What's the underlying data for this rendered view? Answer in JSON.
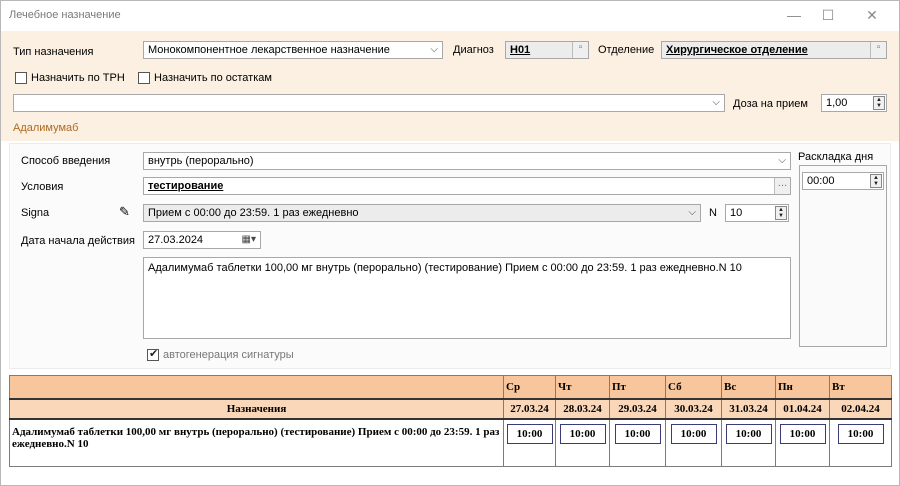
{
  "window": {
    "title": "Лечебное назначение",
    "min": "—",
    "max": "☐",
    "close": "✕"
  },
  "header": {
    "type_label": "Тип назначения",
    "type_value": "Монокомпонентное лекарственное назначение",
    "diagnosis_label": "Диагноз",
    "diagnosis_value": "H01",
    "department_label": "Отделение",
    "department_value": "Хирургическое отделение",
    "check_trn": "Назначить по ТРН",
    "check_stock": "Назначить по остаткам",
    "drug_value": "",
    "dose_label": "Доза на прием",
    "dose_value": "1,00",
    "drug_name": "Адалимумаб"
  },
  "form": {
    "route_label": "Способ введения",
    "route_value": "внутрь (перорально)",
    "conditions_label": "Условия",
    "conditions_value": "тестирование",
    "signa_label": "Signa",
    "signa_value": "Прием с 00:00 до 23:59. 1 раз ежедневно",
    "n_label": "N",
    "n_value": "10",
    "start_label": "Дата начала действия",
    "start_value": "27.03.2024",
    "summary_text": "Адалимумаб таблетки 100,00 мг  внутрь (перорально) (тестирование)  Прием с 00:00 до 23:59. 1 раз ежедневно.N 10",
    "autogen_label": "автогенерация сигнатуры",
    "layout_label": "Раскладка дня",
    "layout_time": "00:00"
  },
  "schedule": {
    "col_header": "Назначения",
    "days": [
      "Ср",
      "Чт",
      "Пт",
      "Сб",
      "Вс",
      "Пн",
      "Вт"
    ],
    "dates": [
      "27.03.24",
      "28.03.24",
      "29.03.24",
      "30.03.24",
      "31.03.24",
      "01.04.24",
      "02.04.24"
    ],
    "row_text": "Адалимумаб таблетки 100,00 мг внутрь (перорально) (тестирование)  Прием с 00:00 до 23:59. 1 раз ежедневно.N 10",
    "times": [
      "10:00",
      "10:00",
      "10:00",
      "10:00",
      "10:00",
      "10:00",
      "10:00"
    ]
  }
}
